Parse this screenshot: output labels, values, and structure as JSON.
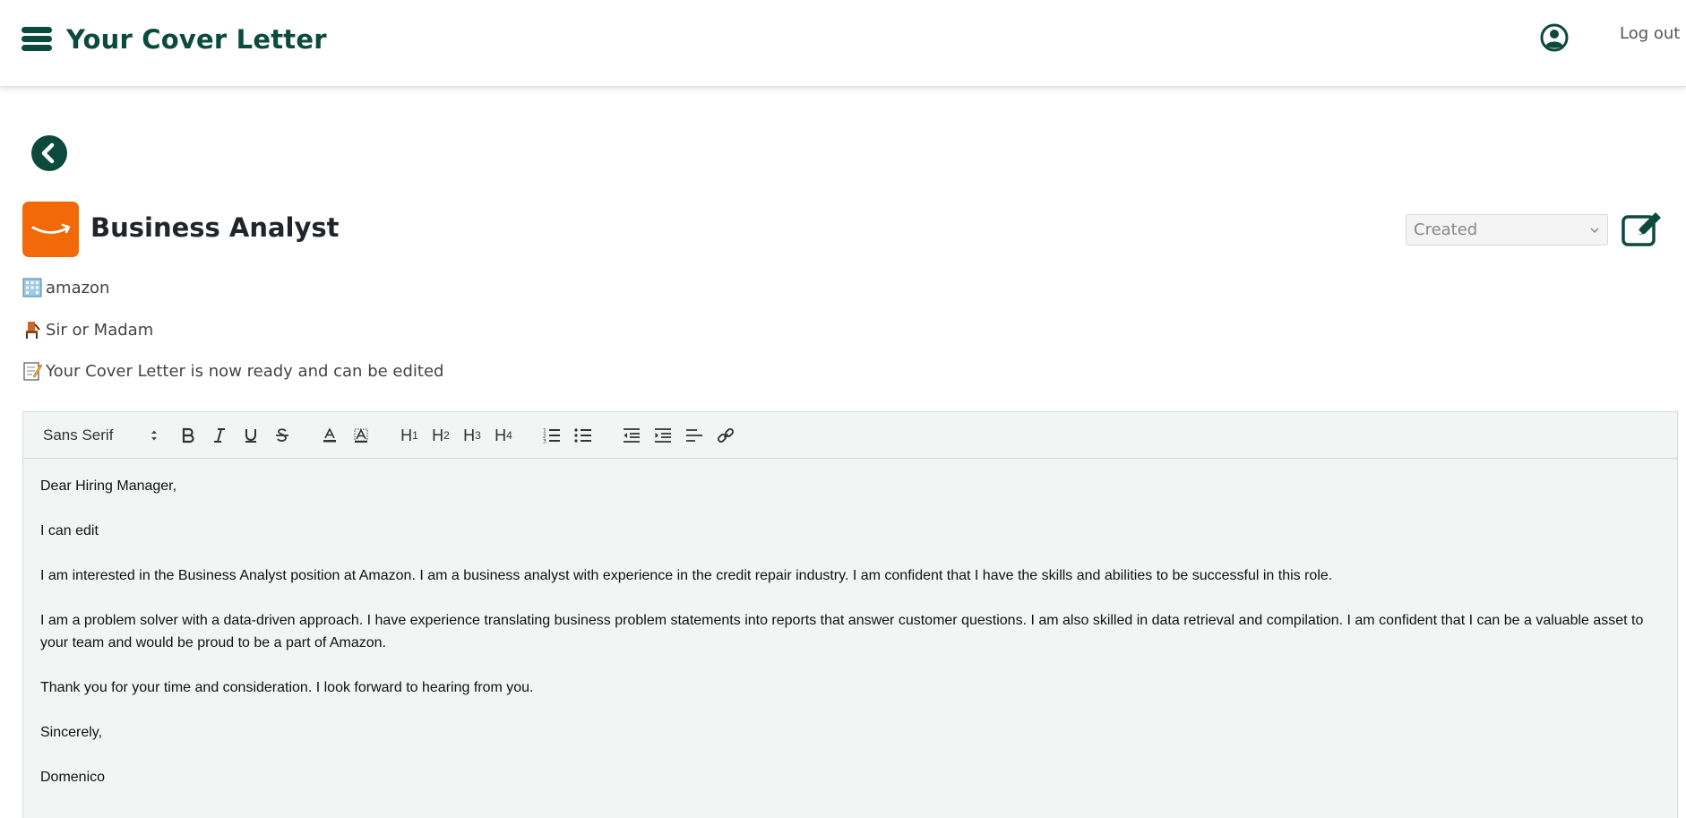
{
  "header": {
    "brand": "Your Cover Letter",
    "logout_label": "Log out",
    "brand_color": "#0d4a3e"
  },
  "job": {
    "title": "Business Analyst",
    "company": "amazon",
    "recipient": "Sir or Madam",
    "status_message": "Your Cover Letter is now ready and can be edited",
    "status_value": "Created",
    "logo_color": "#f26a08"
  },
  "editor": {
    "font": "Sans Serif",
    "paragraphs": [
      "Dear Hiring Manager,",
      "I can edit",
      "I am interested in the Business Analyst position at Amazon. I am a business analyst with experience in the credit repair industry. I am confident that I have the skills and abilities to be successful in this role.",
      "I am a problem solver with a data-driven approach. I have experience translating business problem statements into reports that answer customer questions. I am also skilled in data retrieval and compilation. I am confident that I can be a valuable asset to your team and would be proud to be a part of Amazon.",
      "Thank you for your time and consideration. I look forward to hearing from you.",
      "Sincerely,",
      "Domenico"
    ]
  }
}
